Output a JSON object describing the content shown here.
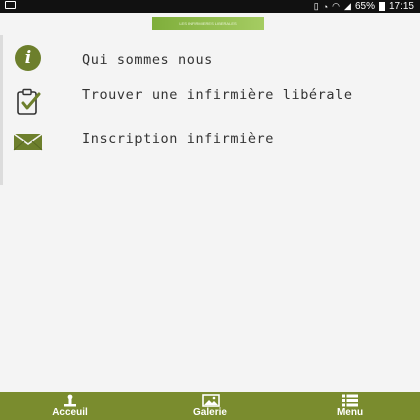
{
  "status_bar": {
    "battery": "65%",
    "time": "17:15"
  },
  "header": {
    "logo_text": "LES INFIRMIERES LIBERALES"
  },
  "menu": {
    "items": [
      {
        "label": "Qui sommes nous",
        "icon": "info-icon"
      },
      {
        "label": "Trouver une infirmière libérale",
        "icon": "clipboard-check-icon"
      },
      {
        "label": "Inscription infirmière",
        "icon": "envelope-icon"
      }
    ]
  },
  "bottom_nav": {
    "tabs": [
      {
        "label": "Acceuil",
        "icon": "home-icon"
      },
      {
        "label": "Galerie",
        "icon": "gallery-icon"
      },
      {
        "label": "Menu",
        "icon": "menu-icon"
      }
    ]
  },
  "colors": {
    "accent": "#7a8c2e",
    "icon": "#6d7f2c",
    "text": "#333333",
    "background": "#f4f4f4"
  }
}
